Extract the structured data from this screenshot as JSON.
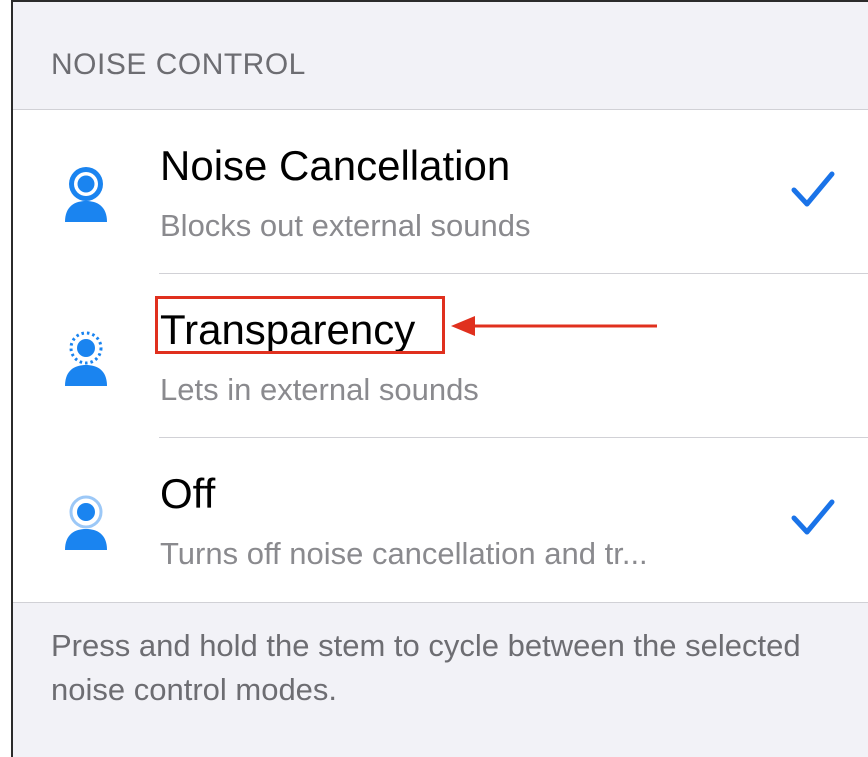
{
  "section": {
    "header": "NOISE CONTROL"
  },
  "options": [
    {
      "title": "Noise Cancellation",
      "subtitle": "Blocks out external sounds",
      "icon": "noise-cancellation-icon",
      "checked": true
    },
    {
      "title": "Transparency",
      "subtitle": "Lets in external sounds",
      "icon": "transparency-icon",
      "checked": false
    },
    {
      "title": "Off",
      "subtitle": "Turns off noise cancellation and tr...",
      "icon": "noise-off-icon",
      "checked": true
    }
  ],
  "footer": {
    "text": "Press and hold the stem to cycle between the selected noise control modes."
  },
  "annotation": {
    "highlight_color": "#e0301e",
    "target": "Transparency"
  },
  "colors": {
    "accent": "#1a73e8",
    "icon_blue": "#1a84f0"
  }
}
